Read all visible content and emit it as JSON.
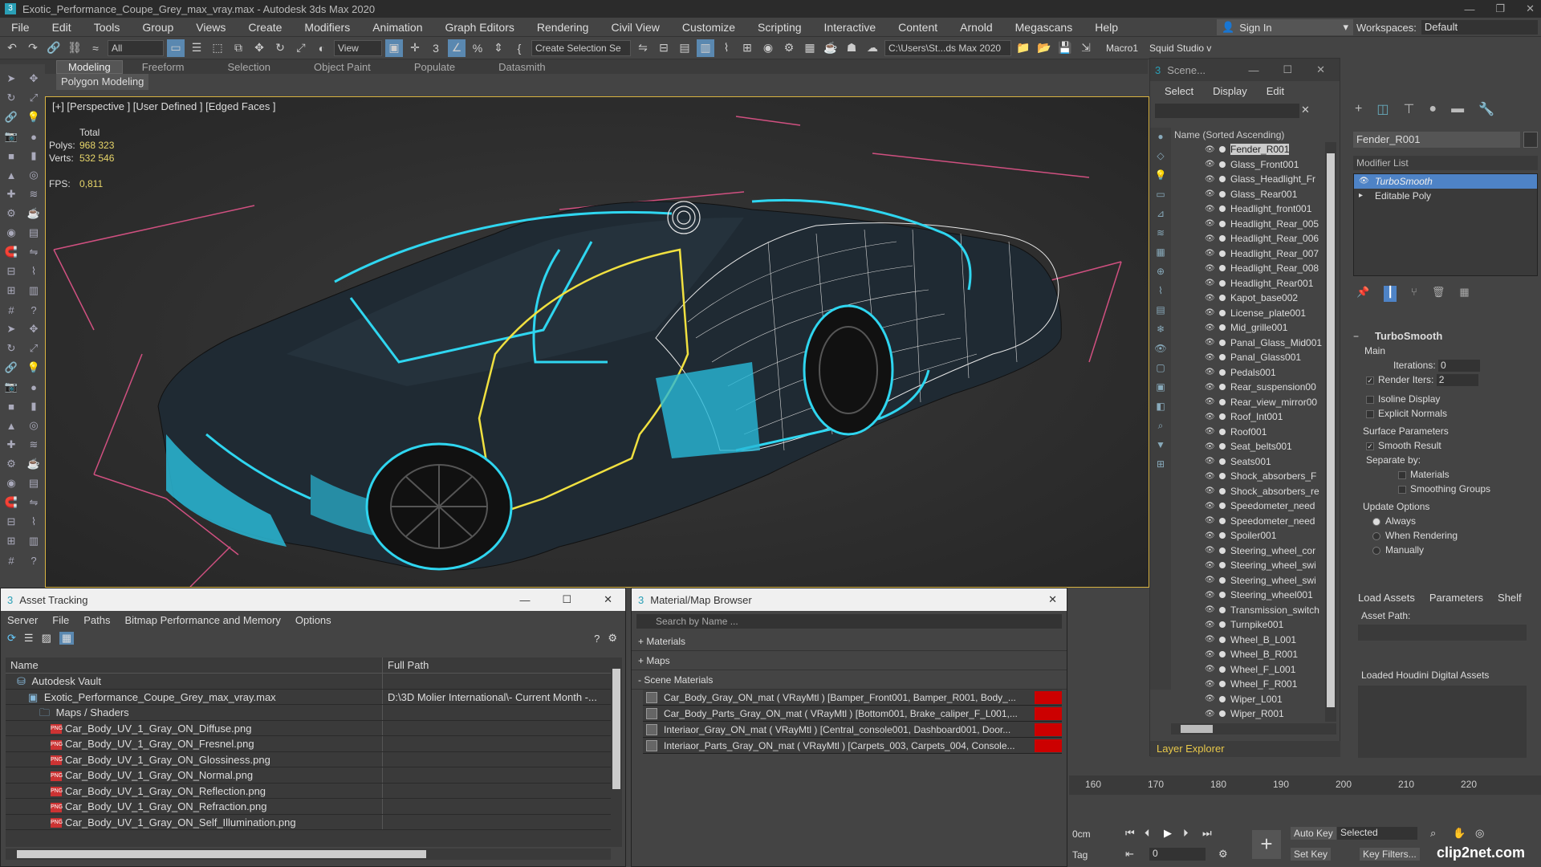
{
  "window": {
    "title": "Exotic_Performance_Coupe_Grey_max_vray.max - Autodesk 3ds Max 2020"
  },
  "menu": [
    "File",
    "Edit",
    "Tools",
    "Group",
    "Views",
    "Create",
    "Modifiers",
    "Animation",
    "Graph Editors",
    "Rendering",
    "Civil View",
    "Customize",
    "Scripting",
    "Interactive",
    "Content",
    "Arnold",
    "Megascans",
    "Help"
  ],
  "account": {
    "sign_in": "Sign In",
    "workspaces_label": "Workspaces:",
    "workspace_value": "Default"
  },
  "toolbar": {
    "filter_value": "All",
    "view_value": "View",
    "selection_set": "Create Selection Se",
    "path_value": "C:\\Users\\St...ds Max 2020",
    "macro": "Macro1",
    "squid": "Squid Studio v"
  },
  "ribbon": {
    "tabs": [
      "Modeling",
      "Freeform",
      "Selection",
      "Object Paint",
      "Populate",
      "Datasmith"
    ],
    "sub": "Polygon Modeling"
  },
  "viewport": {
    "label": "[+] [Perspective ] [User Defined ] [Edged Faces ]",
    "stats": {
      "total": "Total",
      "polys_label": "Polys:",
      "polys": "968 323",
      "verts_label": "Verts:",
      "verts": "532 546",
      "fps_label": "FPS:",
      "fps": "0,811"
    }
  },
  "scene_explorer": {
    "title": "Scene...",
    "menu": [
      "Select",
      "Display",
      "Edit"
    ],
    "column": "Name (Sorted Ascending)",
    "items": [
      "Fender_R001",
      "Glass_Front001",
      "Glass_Headlight_Fr",
      "Glass_Rear001",
      "Headlight_front001",
      "Headlight_Rear_005",
      "Headlight_Rear_006",
      "Headlight_Rear_007",
      "Headlight_Rear_008",
      "Headlight_Rear001",
      "Kapot_base002",
      "License_plate001",
      "Mid_grille001",
      "Panal_Glass_Mid001",
      "Panal_Glass001",
      "Pedals001",
      "Rear_suspension00",
      "Rear_view_mirror00",
      "Roof_Int001",
      "Roof001",
      "Seat_belts001",
      "Seats001",
      "Shock_absorbers_F",
      "Shock_absorbers_re",
      "Speedometer_need",
      "Speedometer_need",
      "Spoiler001",
      "Steering_wheel_cor",
      "Steering_wheel_swi",
      "Steering_wheel_swi",
      "Steering_wheel001",
      "Transmission_switch",
      "Turnpike001",
      "Wheel_B_L001",
      "Wheel_B_R001",
      "Wheel_F_L001",
      "Wheel_F_R001",
      "Wiper_L001",
      "Wiper_R001"
    ],
    "layer_explorer": "Layer Explorer"
  },
  "command_panel": {
    "object_name": "Fender_R001",
    "modifier_list": "Modifier List",
    "stack": [
      "TurboSmooth",
      "Editable Poly"
    ],
    "turbosmooth": {
      "title": "TurboSmooth",
      "main": "Main",
      "iterations_label": "Iterations:",
      "iterations": "0",
      "render_iters_label": "Render Iters:",
      "render_iters": "2",
      "isoline": "Isoline Display",
      "explicit": "Explicit Normals",
      "surface": "Surface Parameters",
      "smooth_result": "Smooth Result",
      "separate": "Separate by:",
      "materials": "Materials",
      "smoothing": "Smoothing Groups",
      "update": "Update Options",
      "always": "Always",
      "when_rendering": "When Rendering",
      "manually": "Manually"
    }
  },
  "asset_tracking": {
    "title": "Asset Tracking",
    "menu": [
      "Server",
      "File",
      "Paths",
      "Bitmap Performance and Memory",
      "Options"
    ],
    "columns": [
      "Name",
      "Full Path"
    ],
    "rows": [
      {
        "name": "Autodesk Vault",
        "path": "",
        "indent": 1,
        "type": "vault"
      },
      {
        "name": "Exotic_Performance_Coupe_Grey_max_vray.max",
        "path": "D:\\3D Molier International\\- Current Month -...",
        "indent": 2,
        "type": "max"
      },
      {
        "name": "Maps / Shaders",
        "path": "",
        "indent": 3,
        "type": "folder"
      },
      {
        "name": "Car_Body_UV_1_Gray_ON_Diffuse.png",
        "path": "",
        "indent": 4,
        "type": "png"
      },
      {
        "name": "Car_Body_UV_1_Gray_ON_Fresnel.png",
        "path": "",
        "indent": 4,
        "type": "png"
      },
      {
        "name": "Car_Body_UV_1_Gray_ON_Glossiness.png",
        "path": "",
        "indent": 4,
        "type": "png"
      },
      {
        "name": "Car_Body_UV_1_Gray_ON_Normal.png",
        "path": "",
        "indent": 4,
        "type": "png"
      },
      {
        "name": "Car_Body_UV_1_Gray_ON_Reflection.png",
        "path": "",
        "indent": 4,
        "type": "png"
      },
      {
        "name": "Car_Body_UV_1_Gray_ON_Refraction.png",
        "path": "",
        "indent": 4,
        "type": "png"
      },
      {
        "name": "Car_Body_UV_1_Gray_ON_Self_Illumination.png",
        "path": "",
        "indent": 4,
        "type": "png"
      }
    ]
  },
  "material_browser": {
    "title": "Material/Map Browser",
    "search_placeholder": "Search by Name ...",
    "sections": [
      "+ Materials",
      "+ Maps",
      "- Scene Materials"
    ],
    "materials": [
      "Car_Body_Gray_ON_mat ( VRayMtl ) [Bamper_Front001, Bamper_R001, Body_...",
      "Car_Body_Parts_Gray_ON_mat ( VRayMtl ) [Bottom001, Brake_caliper_F_L001,...",
      "Interiaor_Gray_ON_mat ( VRayMtl ) [Central_console001, Dashboard001, Door...",
      "Interiaor_Parts_Gray_ON_mat ( VRayMtl ) [Carpets_003, Carpets_004, Console..."
    ]
  },
  "assets_panel": {
    "tabs": [
      "Load Assets",
      "Parameters",
      "Shelf"
    ],
    "asset_path": "Asset Path:",
    "houdini": "Loaded Houdini Digital Assets"
  },
  "timeline": {
    "ticks": [
      "160",
      "170",
      "180",
      "190",
      "200",
      "210",
      "220"
    ]
  },
  "anim": {
    "frame": "0cm",
    "tag": "Tag",
    "frame_value": "0",
    "auto_key": "Auto Key",
    "selected": "Selected",
    "set_key": "Set Key",
    "key_filters": "Key Filters..."
  },
  "watermark": "clip2net.com",
  "colors": {
    "wire_cyan": "#2fd6f0",
    "wire_yellow": "#f0e040",
    "selection_blue": "#4e83c6"
  }
}
